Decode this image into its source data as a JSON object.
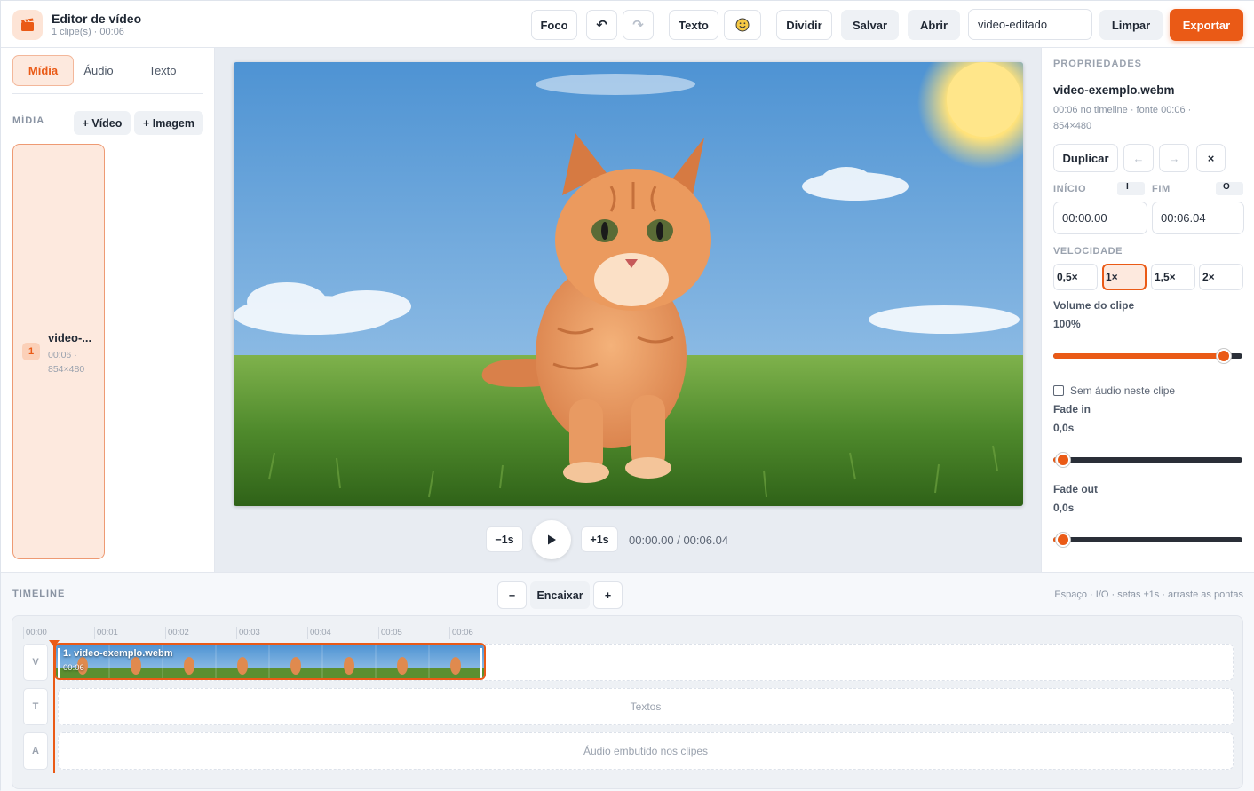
{
  "header": {
    "title": "Editor de vídeo",
    "subtitle": "1 clipe(s) · 00:06",
    "foco": "Foco",
    "undo": "↶",
    "redo": "↷",
    "texto": "Texto",
    "emoji": "☺",
    "dividir": "Dividir",
    "salvar": "Salvar",
    "abrir": "Abrir",
    "project_name": "video-editado",
    "limpar": "Limpar",
    "exportar": "Exportar"
  },
  "sidebar": {
    "tabs": [
      "Mídia",
      "Áudio",
      "Texto"
    ],
    "section": "MÍDIA",
    "add_video": "+ Vídeo",
    "add_image": "+ Imagem",
    "media": [
      {
        "num": "1",
        "name": "video-...",
        "duration": "00:06 ·",
        "resolution": "854×480"
      }
    ]
  },
  "player": {
    "back": "−1s",
    "forward": "+1s",
    "time": "00:00.00 / 00:06.04"
  },
  "props": {
    "section": "PROPRIEDADES",
    "filename": "video-exemplo.webm",
    "meta1": "00:06 no timeline · fonte 00:06 ·",
    "meta2": "854×480",
    "duplicate": "Duplicar",
    "move_left": "←",
    "move_right": "→",
    "delete": "×",
    "start_label": "INÍCIO",
    "start_key": "I",
    "end_label": "FIM",
    "end_key": "O",
    "start_value": "00:00.00",
    "end_value": "00:06.04",
    "speed_label": "VELOCIDADE",
    "speeds": [
      "0,5×",
      "1×",
      "1,5×",
      "2×"
    ],
    "speed_selected": "1×",
    "volume_label": "Volume do clipe",
    "volume_value": "100%",
    "volume_level": 0.9,
    "mute_label": "Sem áudio neste clipe",
    "fade_in_label": "Fade in",
    "fade_in_value": "0,0s",
    "fade_in_level": 0.05,
    "fade_out_label": "Fade out",
    "fade_out_value": "0,0s",
    "fade_out_level": 0.05
  },
  "timeline": {
    "title": "TIMELINE",
    "zoom_out": "−",
    "fit": "Encaixar",
    "zoom_in": "+",
    "hint": "Espaço · I/O · setas ±1s · arraste as pontas",
    "ticks": [
      "00:00",
      "00:01",
      "00:02",
      "00:03",
      "00:04",
      "00:05",
      "00:06"
    ],
    "tracks": {
      "v": "V",
      "t": "T",
      "a": "A"
    },
    "clip_name": "1. video-exemplo.webm",
    "clip_duration": "00:06",
    "text_track": "Textos",
    "audio_track": "Áudio embutido nos clipes"
  },
  "colors": {
    "accent": "#ea5a16",
    "accent_soft": "#fde9de"
  }
}
